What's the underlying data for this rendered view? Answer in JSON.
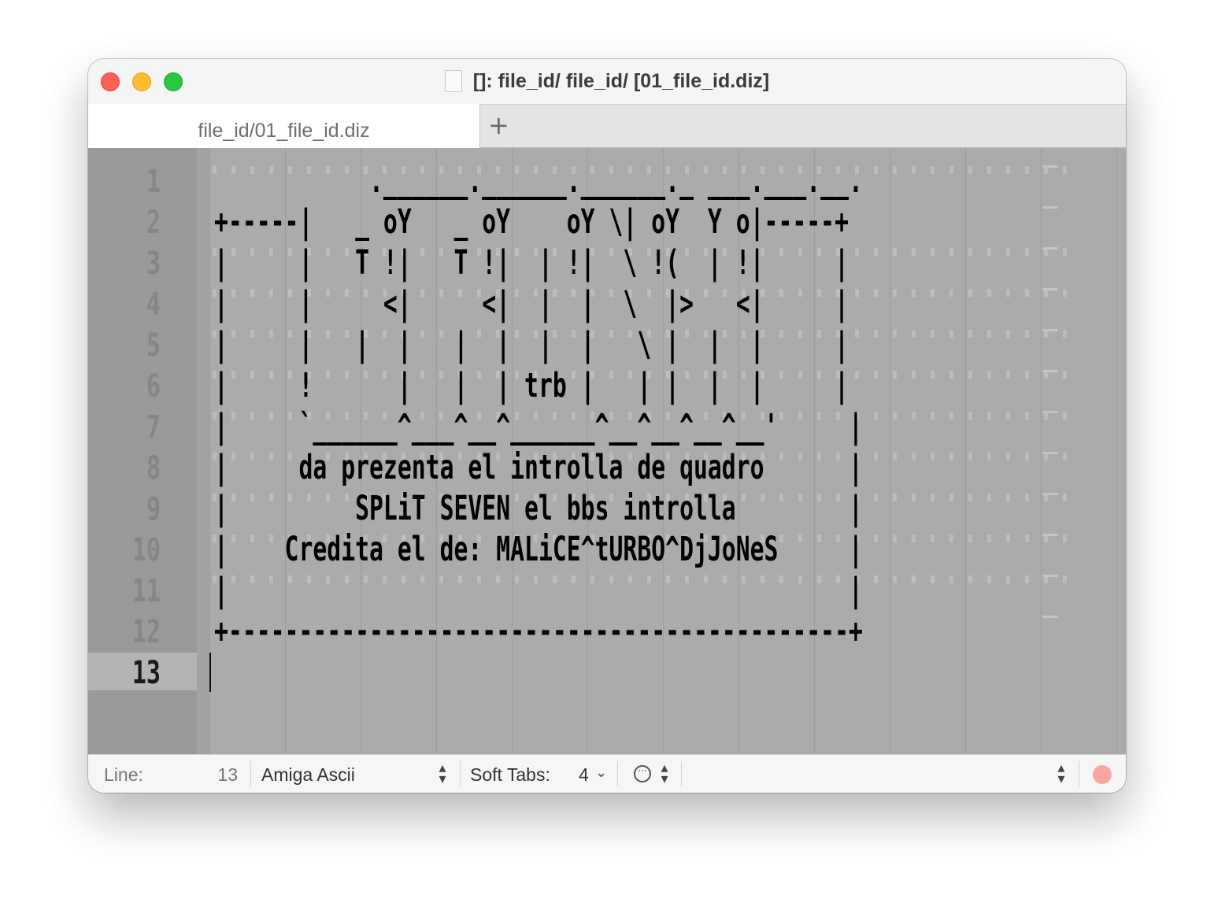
{
  "window": {
    "title": "[]: file_id/ file_id/ [01_file_id.diz]"
  },
  "tabs": {
    "active_label": "file_id/01_file_id.diz",
    "add_label": "+"
  },
  "editor": {
    "line_numbers": [
      "1",
      "2",
      "3",
      "4",
      "5",
      "6",
      "7",
      "8",
      "9",
      "10",
      "11",
      "12",
      "13"
    ],
    "current_line": "13",
    "text": "           .______.______.______._ ___.___.__.\n+-----|   _ oY   _ oY    oY \\| oY  Y o|-----+\n|     |   T !|   T !|  | !|  \\ !(  | !|     |\n|     |     <|     <|  |  |  \\  |>   <|     |\n|     |   |  |   |  |  |  |   \\ |  |  |     |\n|     !      |   |  | trb |   | |  |  |     |\n|     `______^___^__^______^__^__^__^__'     |\n|     da prezenta el introlla de quadro      |\n|         SPLiT SEVEN el bbs introlla        |\n|    Credita el de: MALiCE^tURBO^DjJoNeS     |\n|                                            |\n+--------------------------------------------+\n"
  },
  "statusbar": {
    "line_label": "Line:",
    "line_value": "13",
    "encoding": "Amiga Ascii",
    "soft_tabs_label": "Soft Tabs:",
    "soft_tabs_value": "4",
    "updown_glyph": "⌃⌄"
  },
  "colors": {
    "editor_bg": "#ababab",
    "gutter_bg": "#999999",
    "close": "#fe5f57",
    "minimize": "#febc2e",
    "maximize": "#28c840",
    "record": "#f7a7a1"
  }
}
